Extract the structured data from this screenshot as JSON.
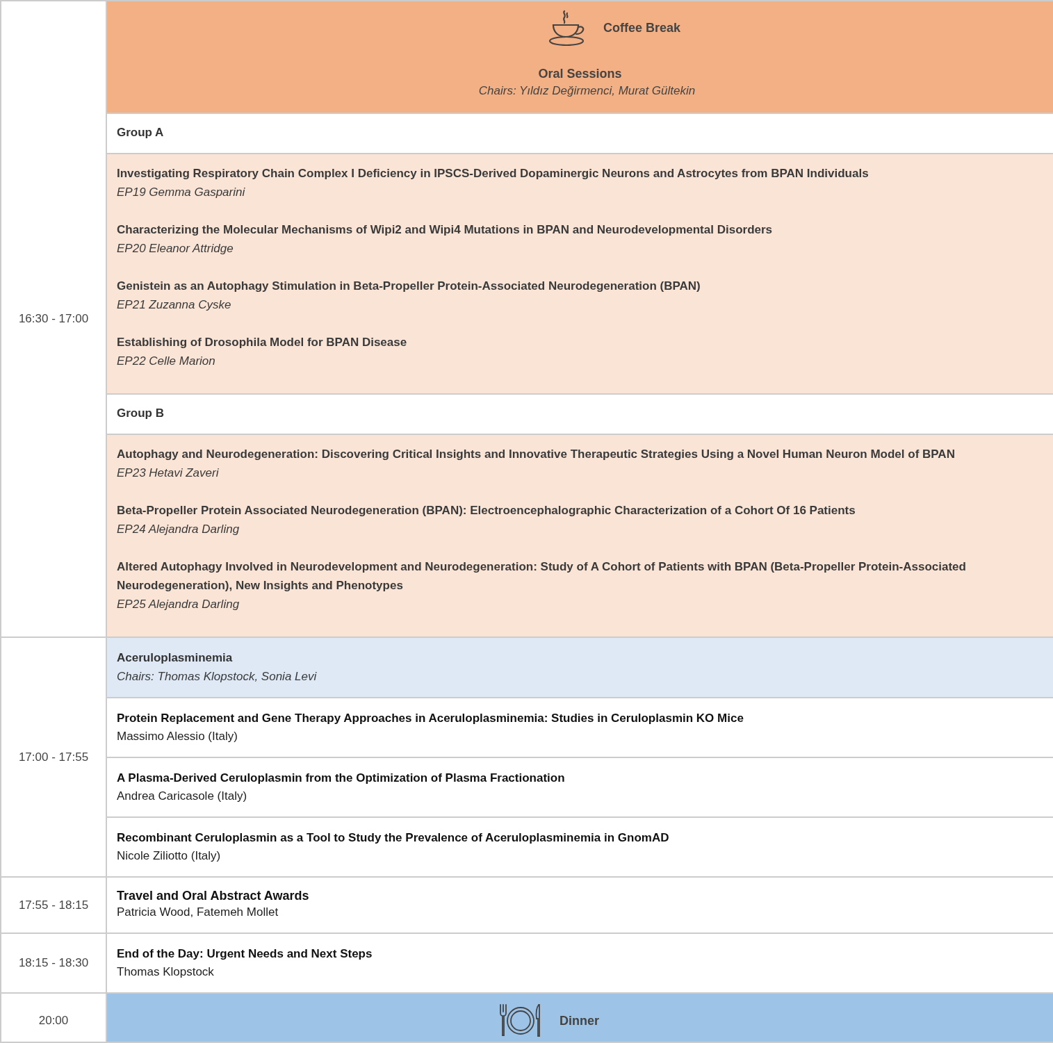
{
  "slots": [
    {
      "time": "16:30 - 17:00",
      "blocks": [
        {
          "kind": "coffee_break",
          "label": "Coffee Break",
          "title": "Oral Sessions",
          "chairs": "Chairs: Yıldız Değirmenci, Murat Gültekin"
        },
        {
          "kind": "group",
          "label": "Group A"
        },
        {
          "kind": "posters",
          "items": [
            {
              "title": "Investigating Respiratory Chain Complex I Deficiency in IPSCS-Derived Dopaminergic Neurons and Astrocytes from BPAN Individuals",
              "author": "EP19 Gemma Gasparini"
            },
            {
              "title": "Characterizing the Molecular Mechanisms of Wipi2 and Wipi4 Mutations in BPAN and Neurodevelopmental Disorders",
              "author": "EP20 Eleanor Attridge"
            },
            {
              "title": "Genistein as an Autophagy Stimulation in Beta-Propeller Protein-Associated Neurodegeneration (BPAN)",
              "author": "EP21 Zuzanna Cyske"
            },
            {
              "title": "Establishing of Drosophila Model for BPAN Disease",
              "author": "EP22 Celle Marion"
            }
          ]
        },
        {
          "kind": "group",
          "label": "Group B"
        },
        {
          "kind": "posters",
          "items": [
            {
              "title": "Autophagy and Neurodegeneration: Discovering Critical Insights and Innovative Therapeutic Strategies Using a Novel Human Neuron Model of BPAN",
              "author": "EP23 Hetavi Zaveri"
            },
            {
              "title": "Beta-Propeller Protein Associated Neurodegeneration (BPAN): Electroencephalographic Characterization of a Cohort Of 16 Patients",
              "author": "EP24 Alejandra Darling"
            },
            {
              "title": "Altered Autophagy Involved in Neurodevelopment and Neurodegeneration: Study of A Cohort of Patients with BPAN (Beta-Propeller Protein-Associated Neurodegeneration), New Insights and Phenotypes",
              "author": "EP25 Alejandra Darling"
            }
          ]
        }
      ]
    },
    {
      "time": "17:00 - 17:55",
      "blocks": [
        {
          "kind": "session",
          "title": "Aceruloplasminemia",
          "chairs": "Chairs: Thomas Klopstock, Sonia Levi"
        },
        {
          "kind": "talk",
          "title": "Protein Replacement and Gene Therapy Approaches in Aceruloplasminemia: Studies in Ceruloplasmin KO Mice",
          "speaker": "Massimo Alessio (Italy)"
        },
        {
          "kind": "talk",
          "title": "A Plasma-Derived Ceruloplasmin from the Optimization of Plasma Fractionation",
          "speaker": "Andrea Caricasole (Italy)"
        },
        {
          "kind": "talk",
          "title": "Recombinant Ceruloplasmin as a Tool to Study the Prevalence of Aceruloplasminemia in GnomAD",
          "speaker": "Nicole Ziliotto (Italy)"
        }
      ]
    },
    {
      "time": "17:55 - 18:15",
      "blocks": [
        {
          "kind": "award",
          "title": "Travel and Oral Abstract Awards",
          "speaker": "Patricia Wood, Fatemeh Mollet"
        }
      ]
    },
    {
      "time": "18:15 - 18:30",
      "blocks": [
        {
          "kind": "talk",
          "title": "End of the Day: Urgent Needs and Next Steps",
          "speaker": "Thomas Klopstock"
        }
      ]
    },
    {
      "time": "20:00",
      "blocks": [
        {
          "kind": "dinner",
          "label": "Dinner"
        }
      ]
    }
  ]
}
